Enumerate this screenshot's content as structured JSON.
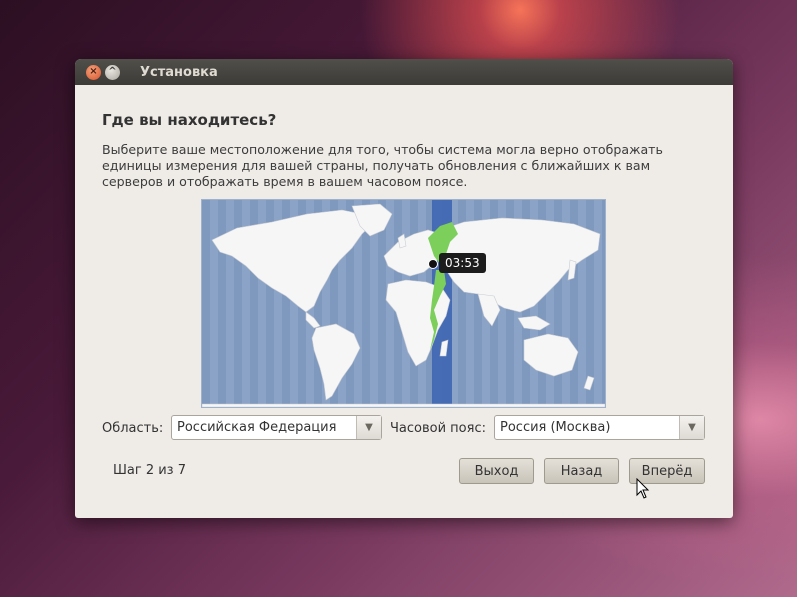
{
  "window": {
    "title": "Установка",
    "close_glyph": "×",
    "minimize_glyph": "^"
  },
  "heading": "Где вы находитесь?",
  "description": "Выберите ваше местоположение для того, чтобы система могла верно отображать единицы измерения для вашей страны, получать обновления с ближайших к вам серверов и отображать время в вашем часовом поясе.",
  "map": {
    "time_label": "03:53",
    "ocean_color": "#8aa2c5",
    "land_color": "#f6f6f6",
    "highlight_color": "#7ccf5a",
    "band_color": "#3a63b3"
  },
  "region": {
    "label": "Область:",
    "value": "Российская Федерация"
  },
  "timezone": {
    "label": "Часовой пояс:",
    "value": "Россия (Москва)"
  },
  "step_text": "Шаг 2 из 7",
  "buttons": {
    "quit": "Выход",
    "back": "Назад",
    "forward": "Вперёд"
  }
}
